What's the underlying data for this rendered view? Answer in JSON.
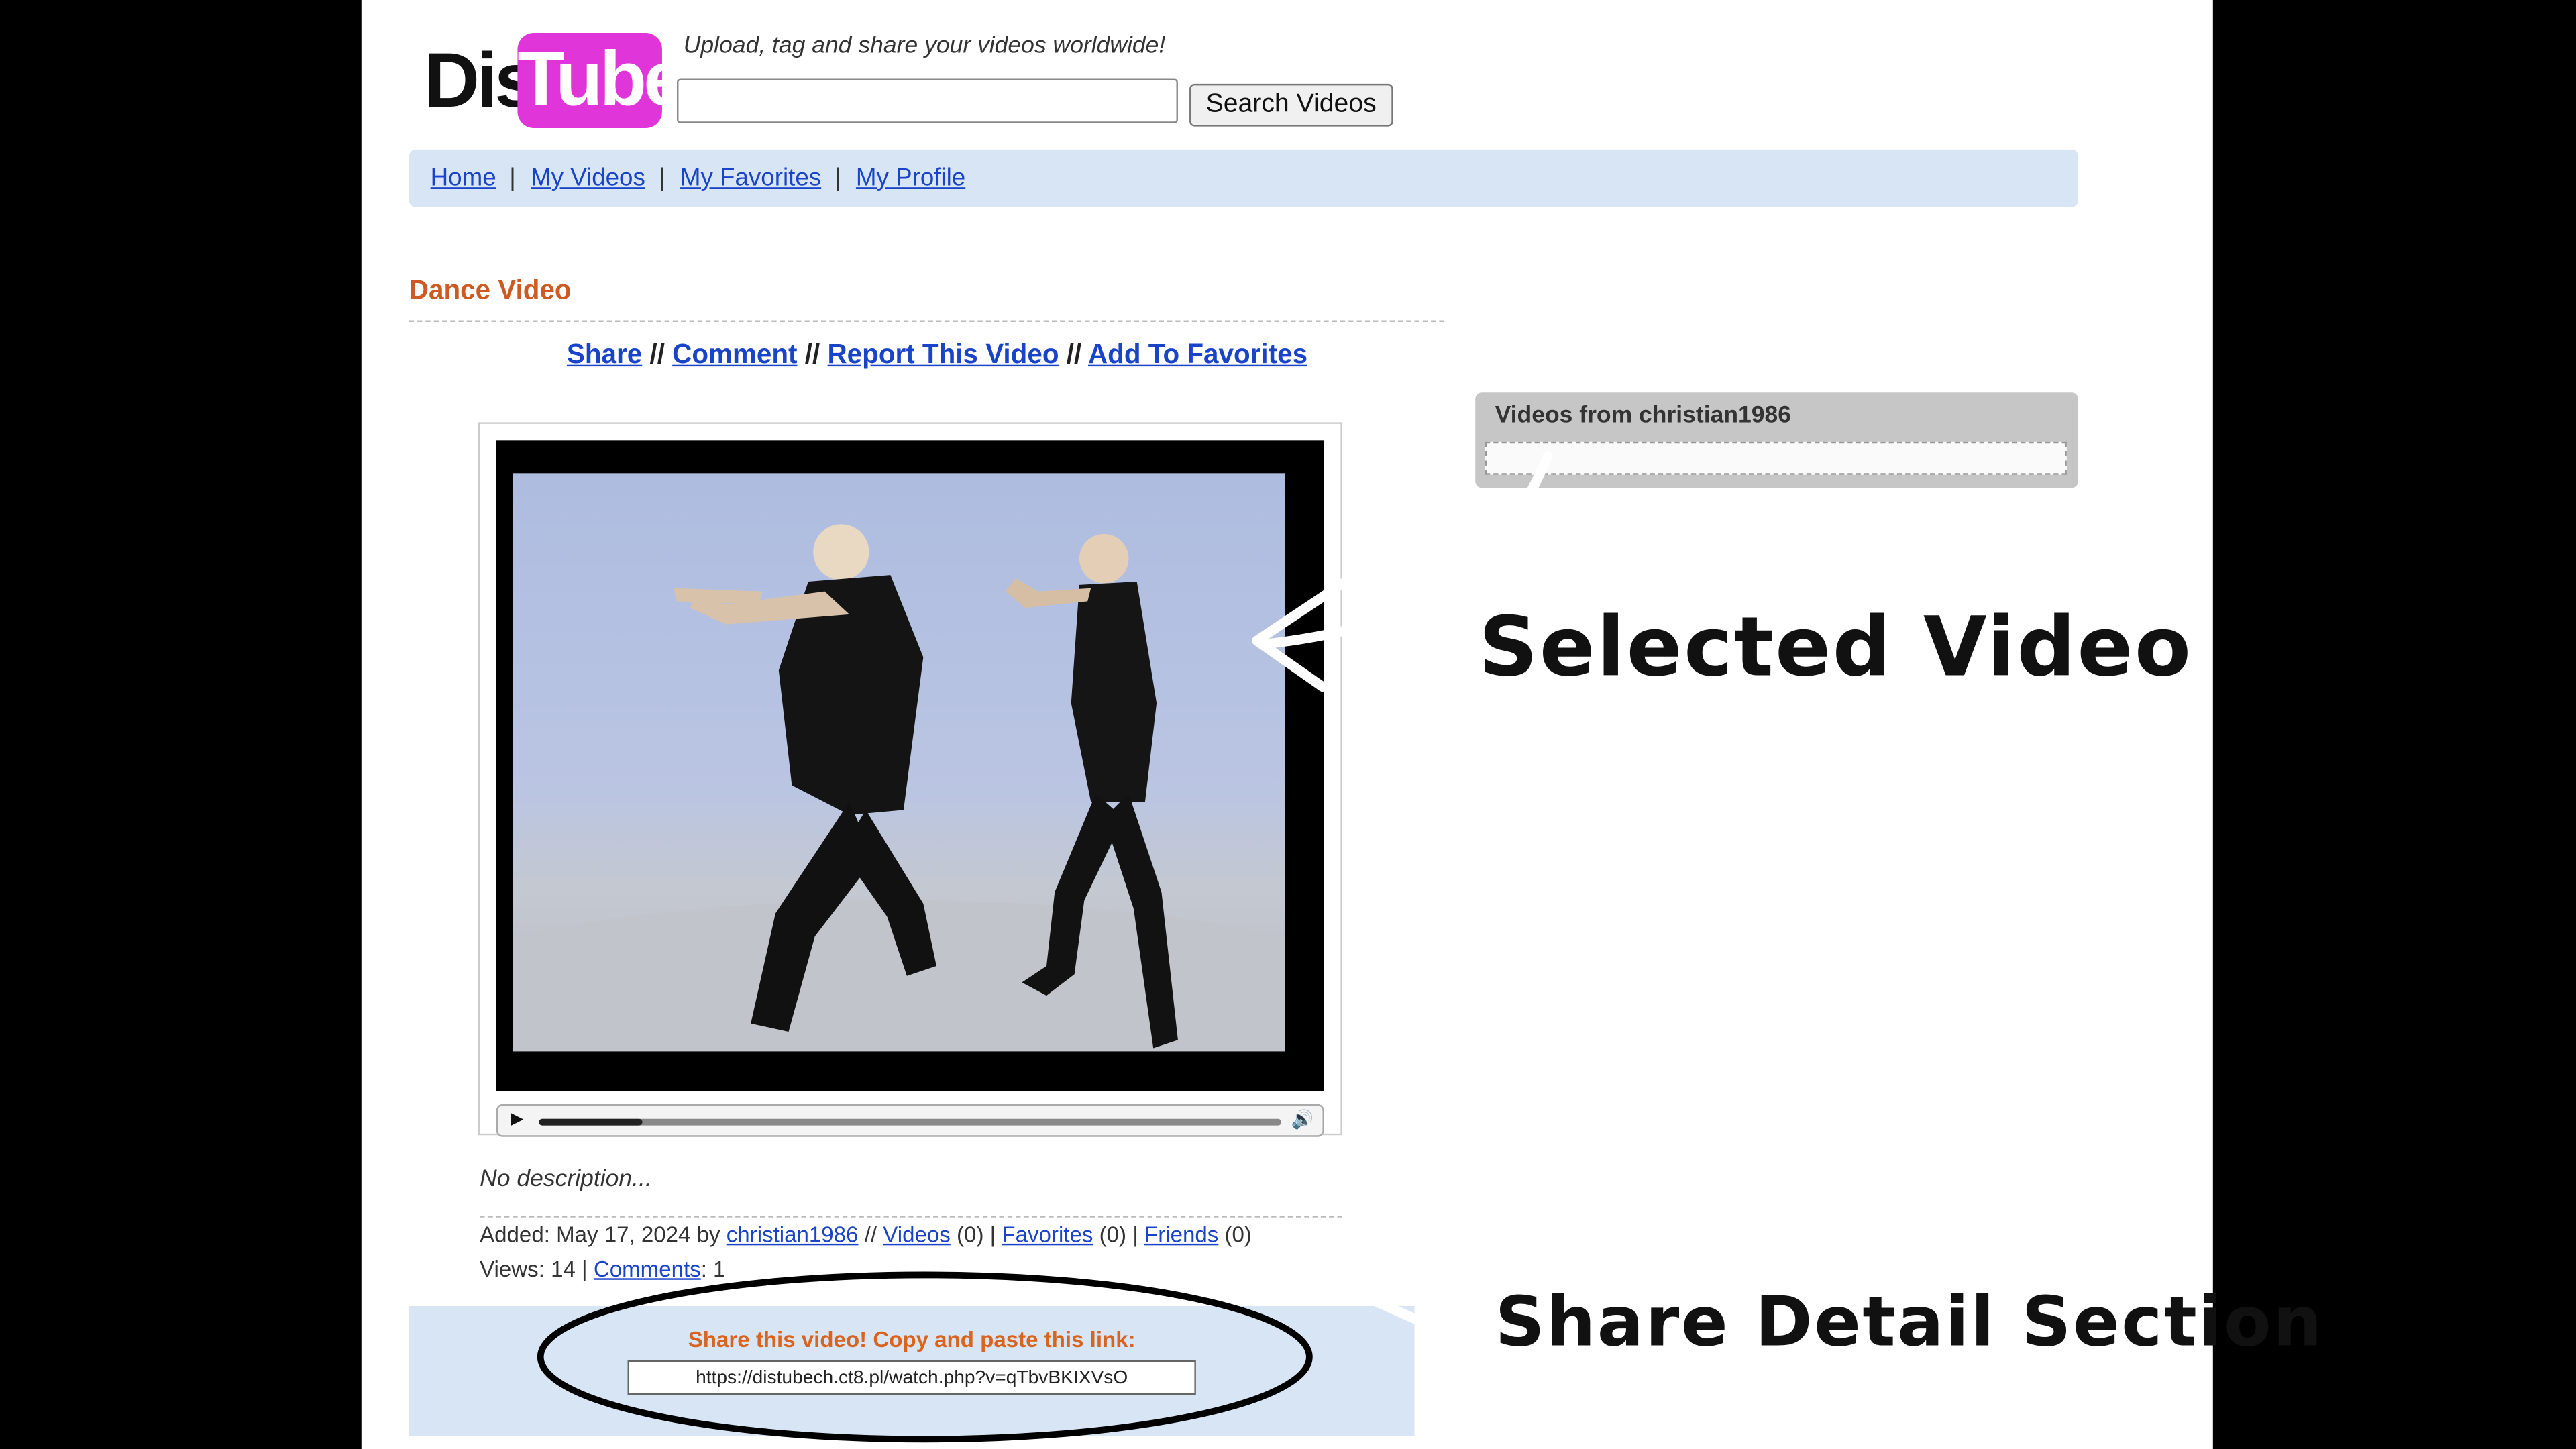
{
  "brand": {
    "logo_part1": "Dis",
    "logo_part2": "Tube",
    "tagline": "Upload, tag and share your videos worldwide!"
  },
  "search": {
    "placeholder": "",
    "button_label": "Search Videos"
  },
  "nav": {
    "items": [
      "Home",
      "My Videos",
      "My Favorites",
      "My Profile"
    ],
    "separator": "|"
  },
  "video": {
    "title": "Dance Video",
    "actions": [
      "Share",
      "Comment",
      "Report This Video",
      "Add To Favorites"
    ],
    "action_separator": "//",
    "progress": 0.14,
    "description": "No description...",
    "added_prefix": "Added: May 17, 2024 by",
    "uploader": "christian1986",
    "videos_label": "Videos",
    "videos_count": "(0)",
    "favorites_label": "Favorites",
    "favorites_count": "(0)",
    "friends_label": "Friends",
    "friends_count": "(0)",
    "views_text": "Views: 14 |",
    "comments_label": "Comments",
    "comments_count": ": 1"
  },
  "share": {
    "title": "Share this video! Copy and paste this link:",
    "link": "https://distubech.ct8.pl/watch.php?v=qTbvBKIXVsO"
  },
  "sidebar": {
    "title": "Videos from christian1986"
  },
  "annotations": {
    "selected_video": "Selected Video",
    "share_section": "Share Detail Section"
  },
  "colors": {
    "accent_orange": "#cc5a22",
    "link_blue": "#1a44c8",
    "nav_bg": "#d7e5f5",
    "logo_pink": "#e035d8"
  }
}
